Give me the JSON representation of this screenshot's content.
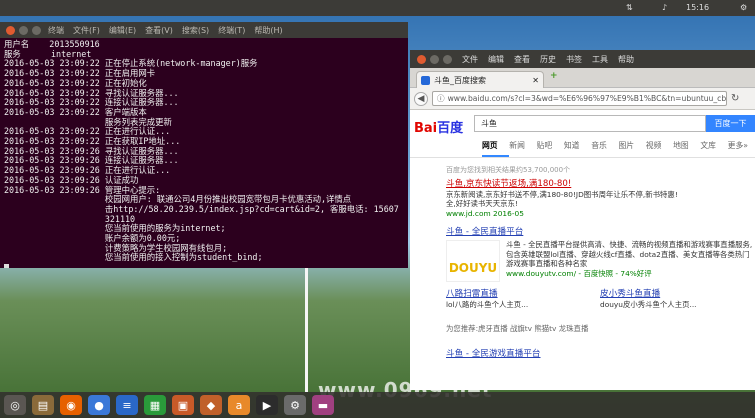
{
  "top_panel": {
    "time": "15:16",
    "icons": [
      "network-icon",
      "sound-icon",
      "settings-icon"
    ]
  },
  "terminal": {
    "menu": [
      "终端",
      "文件(F)",
      "编辑(E)",
      "查看(V)",
      "搜索(S)",
      "终端(T)",
      "帮助(H)"
    ],
    "lines": [
      "用户名    2013550916",
      "服务      internet",
      "2016-05-03 23:09:22 正在停止系统(network-manager)服务",
      "2016-05-03 23:09:22 正在启用网卡",
      "2016-05-03 23:09:22 正在初始化",
      "2016-05-03 23:09:22 寻找认证服务器...",
      "2016-05-03 23:09:22 连接认证服务器...",
      "2016-05-03 23:09:22 客户端版本",
      "                    服务列表完成更新",
      "2016-05-03 23:09:22 正在进行认证...",
      "2016-05-03 23:09:22 正在获取IP地址...",
      "2016-05-03 23:09:26 寻找认证服务器...",
      "2016-05-03 23:09:26 连接认证服务器...",
      "2016-05-03 23:09:26 正在进行认证...",
      "2016-05-03 23:09:26 认证成功",
      "2016-05-03 23:09:26 管理中心提示:",
      "                    校园网用户: 联通公司4月份推出校园宽带包月卡优惠活动,详情点",
      "                    击http://58.20.239.5/index.jsp?cd=cart&id=2, 客服电话: 15607",
      "                    321110",
      "                    您当前使用的服务为internet;",
      "                    账户余额为0.00元;",
      "                    计费策略为学生校园网有线包月;",
      "                    您当前使用的接入控制为student_bind;"
    ]
  },
  "firefox": {
    "menu": [
      "文件",
      "编辑",
      "查看",
      "历史",
      "书签",
      "工具",
      "帮助"
    ],
    "tab_title": "斗鱼_百度搜索",
    "url": "www.baidu.com/s?cl=3&wd=%E6%96%97%E9%B1%BC&tn=ubuntuu_cb",
    "baidu": {
      "logo_a": "Bai",
      "logo_b": "百度",
      "query": "斗鱼",
      "search_button": "百度一下",
      "tabs": [
        "网页",
        "新闻",
        "贴吧",
        "知道",
        "音乐",
        "图片",
        "视频",
        "地图",
        "文库",
        "更多»"
      ],
      "result_count": "百度为您找到相关结果约53,700,000个",
      "ad": {
        "title": "斗鱼,京东快读节返场,满180-80!",
        "desc": "京东新阅读,京东好书送不停,满180-80!JD图书周年让乐不停,新书特惠!",
        "desc2": "全,好好读书天天京东!",
        "url": "www.jd.com 2016-05"
      },
      "r1": {
        "title": "斗鱼 - 全民直播平台",
        "desc": "斗鱼 - 全民直播平台提供高清、快捷、流畅的视频直播和游戏赛事直播服务,包含英雄联盟lol直播、穿越火线cf直播、dota2直播、美女直播等各类热门游戏赛事直播和各种名家",
        "url": "www.douyutv.com/ - 百度快照 - 74%好评",
        "logo": "DOUYU"
      },
      "sub1": {
        "title": "八路扫雷直播",
        "desc": "lol八路的斗鱼个人主页..."
      },
      "sub2": {
        "title": "皮小秀斗鱼直播",
        "desc": "douyu皮小秀斗鱼个人主页..."
      },
      "related": "为您推荐:虎牙直播  战旗tv  熊猫tv  龙珠直播",
      "r2": {
        "title": "斗鱼 - 全民游戏直播平台"
      }
    }
  },
  "watermark": "www.0969.net",
  "dock": [
    {
      "name": "dash-icon",
      "glyph": "◎",
      "color": "#5a5652"
    },
    {
      "name": "files-icon",
      "glyph": "▤",
      "color": "#8a6a3a"
    },
    {
      "name": "firefox-icon",
      "glyph": "◉",
      "color": "#e66000"
    },
    {
      "name": "chromium-icon",
      "glyph": "●",
      "color": "#3a78d8"
    },
    {
      "name": "writer-icon",
      "glyph": "≡",
      "color": "#2a68c8"
    },
    {
      "name": "calc-icon",
      "glyph": "▦",
      "color": "#2a9a3a"
    },
    {
      "name": "impress-icon",
      "glyph": "▣",
      "color": "#c85a28"
    },
    {
      "name": "software-center-icon",
      "glyph": "◆",
      "color": "#c0602a"
    },
    {
      "name": "amazon-icon",
      "glyph": "a",
      "color": "#e8892a"
    },
    {
      "name": "terminal-icon",
      "glyph": "▶",
      "color": "#2c2c2c"
    },
    {
      "name": "system-settings-icon",
      "glyph": "⚙",
      "color": "#6a6a6a"
    },
    {
      "name": "app-icon",
      "glyph": "▬",
      "color": "#a04080"
    }
  ]
}
